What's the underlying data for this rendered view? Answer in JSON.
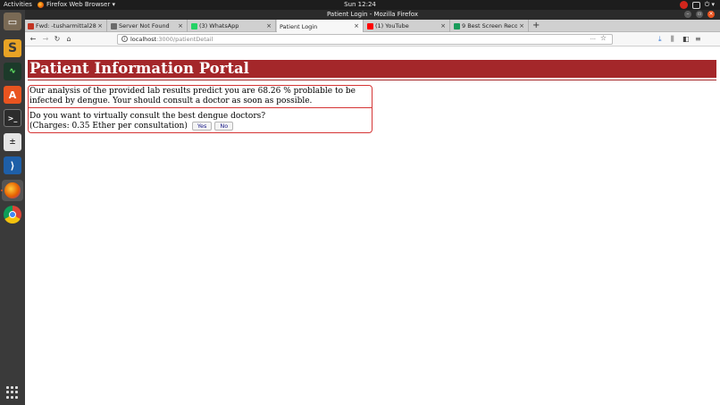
{
  "system": {
    "activities": "Activities",
    "app_menu": "Firefox Web Browser ▾",
    "clock": "Sun 12:24",
    "tray_power": "⏻ ▾"
  },
  "window": {
    "title": "Patient Login - Mozilla Firefox"
  },
  "tabs": [
    {
      "label": "Fwd: -tusharmittal28",
      "favicon_color": "#c23321"
    },
    {
      "label": "Server Not Found",
      "favicon_color": "#6b6b6b"
    },
    {
      "label": "(3) WhatsApp",
      "favicon_color": "#25d366"
    },
    {
      "label": "Patient Login",
      "favicon_color": ""
    },
    {
      "label": "(1) YouTube",
      "favicon_color": "#ff0000"
    },
    {
      "label": "9 Best Screen Recorders",
      "favicon_color": "#1a9c5a"
    }
  ],
  "url": {
    "host": "localhost",
    "path": ":3000/patientDetail"
  },
  "page": {
    "header_title": "Patient Information Portal",
    "result_text": "Our analysis of the provided lab results predict you are 68.26 % problable to be infected by dengue. Your should consult a doctor as soon as possible.",
    "consult_question": "Do you want to virtually consult the best dengue doctors?",
    "charges_text": "(Charges: 0.35 Ether per consultation)",
    "yes_label": "Yes",
    "no_label": "No"
  },
  "colors": {
    "header_bg": "#a4272a",
    "box_border": "#d53535",
    "accent": "#e95420"
  }
}
